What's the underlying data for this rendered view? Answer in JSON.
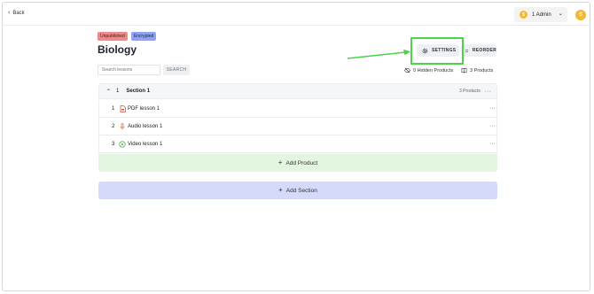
{
  "nav": {
    "back_label": "Back"
  },
  "account": {
    "coin_letter": "$",
    "admin_label": "1 Admin",
    "avatar_letter": "S"
  },
  "course": {
    "badges": [
      {
        "label": "Unpublished",
        "color": "#f08a8a"
      },
      {
        "label": "Encrypted",
        "color": "#8fa2f4"
      }
    ],
    "title": "Biology"
  },
  "actions": {
    "settings_label": "SETTINGS",
    "reorder_label": "REORDER"
  },
  "search": {
    "placeholder": "Search lessons",
    "button_label": "SEARCH"
  },
  "summary": {
    "hidden_products": "0 Hidden Products",
    "products": "3 Products"
  },
  "section": {
    "number": "1",
    "name": "Section 1",
    "product_count": "3 Products",
    "more_icon": "ellipsis-icon",
    "lessons": [
      {
        "index": "1",
        "icon": "pdf-icon",
        "label": "PDF lesson 1"
      },
      {
        "index": "2",
        "icon": "microphone-icon",
        "label": "Audio lesson 1"
      },
      {
        "index": "3",
        "icon": "play-circle-icon",
        "label": "Video lesson 1"
      }
    ],
    "add_product_label": "Add Product"
  },
  "add_section_label": "Add Section",
  "colors": {
    "highlight": "#4cd34a",
    "accent_yellow": "#f5b731",
    "add_product_bg": "#e3f6df",
    "add_section_bg": "#d4dafa"
  }
}
